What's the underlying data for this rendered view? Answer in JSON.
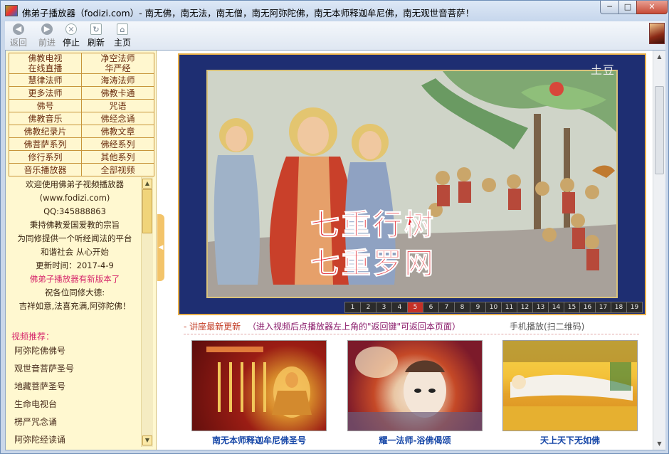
{
  "window": {
    "title": "佛弟子播放器（fodizi.com）- 南无佛，南无法，南无僧，南无阿弥陀佛，南无本师释迦牟尼佛，南无观世音菩萨！",
    "min_glyph": "─",
    "max_glyph": "□",
    "close_glyph": "✕"
  },
  "toolbar": {
    "back": "返回",
    "forward": "前进",
    "stop": "停止",
    "refresh": "刷新",
    "home": "主页",
    "back_glyph": "◀",
    "forward_glyph": "▶",
    "stop_glyph": "✕",
    "refresh_glyph": "↻",
    "home_glyph": "⌂"
  },
  "menu": {
    "rows": [
      [
        "佛教电视\n在线直播",
        "净空法师\n华严经"
      ],
      [
        "慧律法师",
        "海涛法师"
      ],
      [
        "更多法师",
        "佛教卡通"
      ],
      [
        "佛号",
        "咒语"
      ],
      [
        "佛教音乐",
        "佛经念诵"
      ],
      [
        "佛教纪录片",
        "佛教文章"
      ],
      [
        "佛菩萨系列",
        "佛经系列"
      ],
      [
        "修行系列",
        "其他系列"
      ],
      [
        "音乐播放器",
        "全部视频"
      ]
    ]
  },
  "info": {
    "line1": "欢迎使用佛弟子视频播放器",
    "line2": "(www.fodizi.com)",
    "line3": "QQ:345888863",
    "line4": "秉持佛教爱国爱教的宗旨",
    "line5": "为同修提供一个听经闻法的平台",
    "line6": "和谐社会 从心开始",
    "line7": "更新时间：2017-4-9",
    "notice": "佛弟子播放器有新版本了",
    "line8": "祝各位同修大德:",
    "line9": "吉祥如意,法喜充满,阿弥陀佛！"
  },
  "recommend": {
    "heading": "视频推荐：",
    "items": [
      "阿弥陀佛佛号",
      "观世音菩萨圣号",
      "地藏菩萨圣号",
      "生命电视台",
      "楞严咒念诵",
      "阿弥陀经读诵"
    ]
  },
  "player": {
    "logo": "土豆",
    "title_line1": "七重行树",
    "title_line2": "七重罗网",
    "pages": [
      "1",
      "2",
      "3",
      "4",
      "5",
      "6",
      "7",
      "8",
      "9",
      "10",
      "11",
      "12",
      "13",
      "14",
      "15",
      "16",
      "17",
      "18",
      "19"
    ],
    "current_page": "5"
  },
  "news": {
    "label": "- 讲座最新更新",
    "hint": "（进入视频后点播放器左上角的\"返回键\"可返回本页面）",
    "mobile": "手机播放(扫二维码)"
  },
  "cards": [
    {
      "caption": "南无本师释迦牟尼佛圣号"
    },
    {
      "caption": "耀一法师-浴佛偈颂"
    },
    {
      "caption": "天上天下无如佛"
    }
  ],
  "scroll": {
    "up": "▲",
    "down": "▼",
    "collapse": "◀"
  },
  "colors": {
    "accent_pink": "#d6246a",
    "menu_text": "#6b2e10",
    "caption_blue": "#1848a8",
    "active_page": "#c43028"
  }
}
